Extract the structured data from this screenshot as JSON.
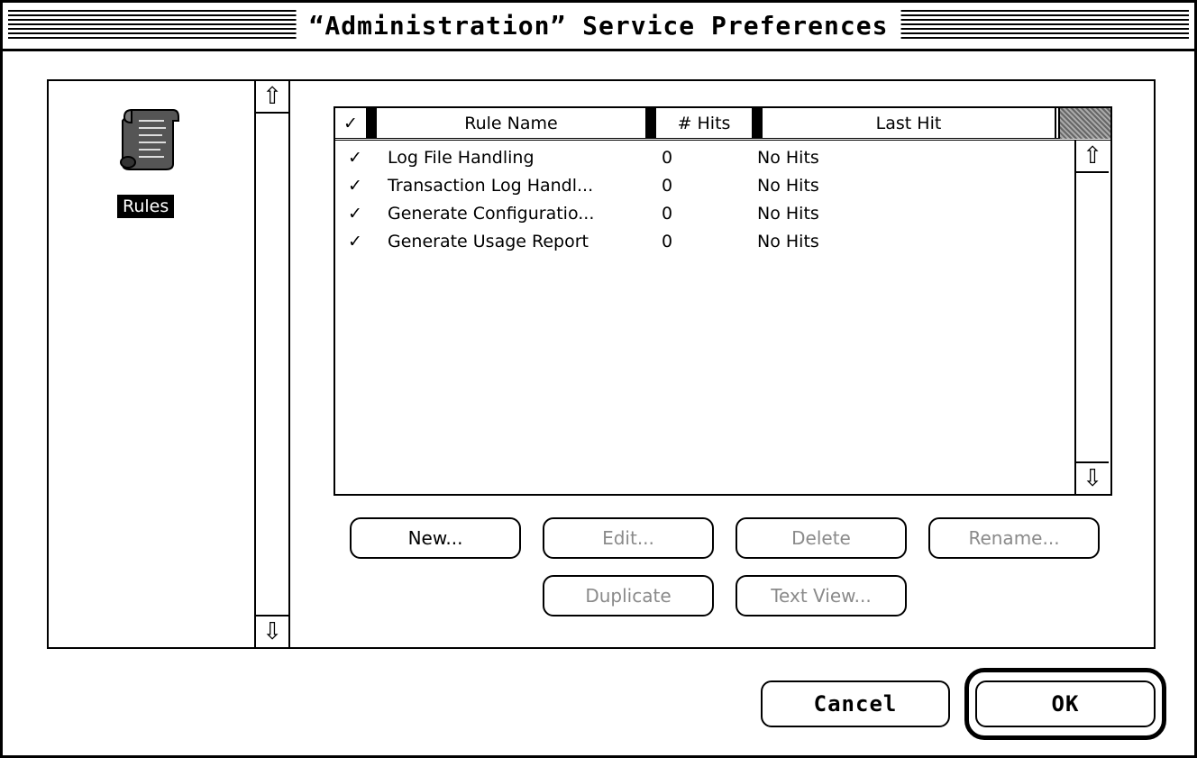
{
  "window": {
    "title": "“Administration” Service Preferences"
  },
  "sidebar": {
    "items": [
      {
        "label": "Rules",
        "icon": "scroll-icon",
        "selected": true
      }
    ]
  },
  "table": {
    "header_check": "✓",
    "columns": [
      "Rule Name",
      "# Hits",
      "Last Hit"
    ],
    "rows": [
      {
        "check": "✓",
        "name": "Log File Handling",
        "hits": "0",
        "last_hit": "No Hits"
      },
      {
        "check": "✓",
        "name": "Transaction Log Handl...",
        "hits": "0",
        "last_hit": "No Hits"
      },
      {
        "check": "✓",
        "name": "Generate Configuratio...",
        "hits": "0",
        "last_hit": "No Hits"
      },
      {
        "check": "✓",
        "name": "Generate Usage Report",
        "hits": "0",
        "last_hit": "No Hits"
      }
    ]
  },
  "actions": {
    "new": "New...",
    "edit": "Edit...",
    "delete": "Delete",
    "rename": "Rename...",
    "duplicate": "Duplicate",
    "text_view": "Text View..."
  },
  "dialog": {
    "cancel": "Cancel",
    "ok": "OK"
  },
  "icons": {
    "up": "⇧",
    "down": "⇩"
  }
}
